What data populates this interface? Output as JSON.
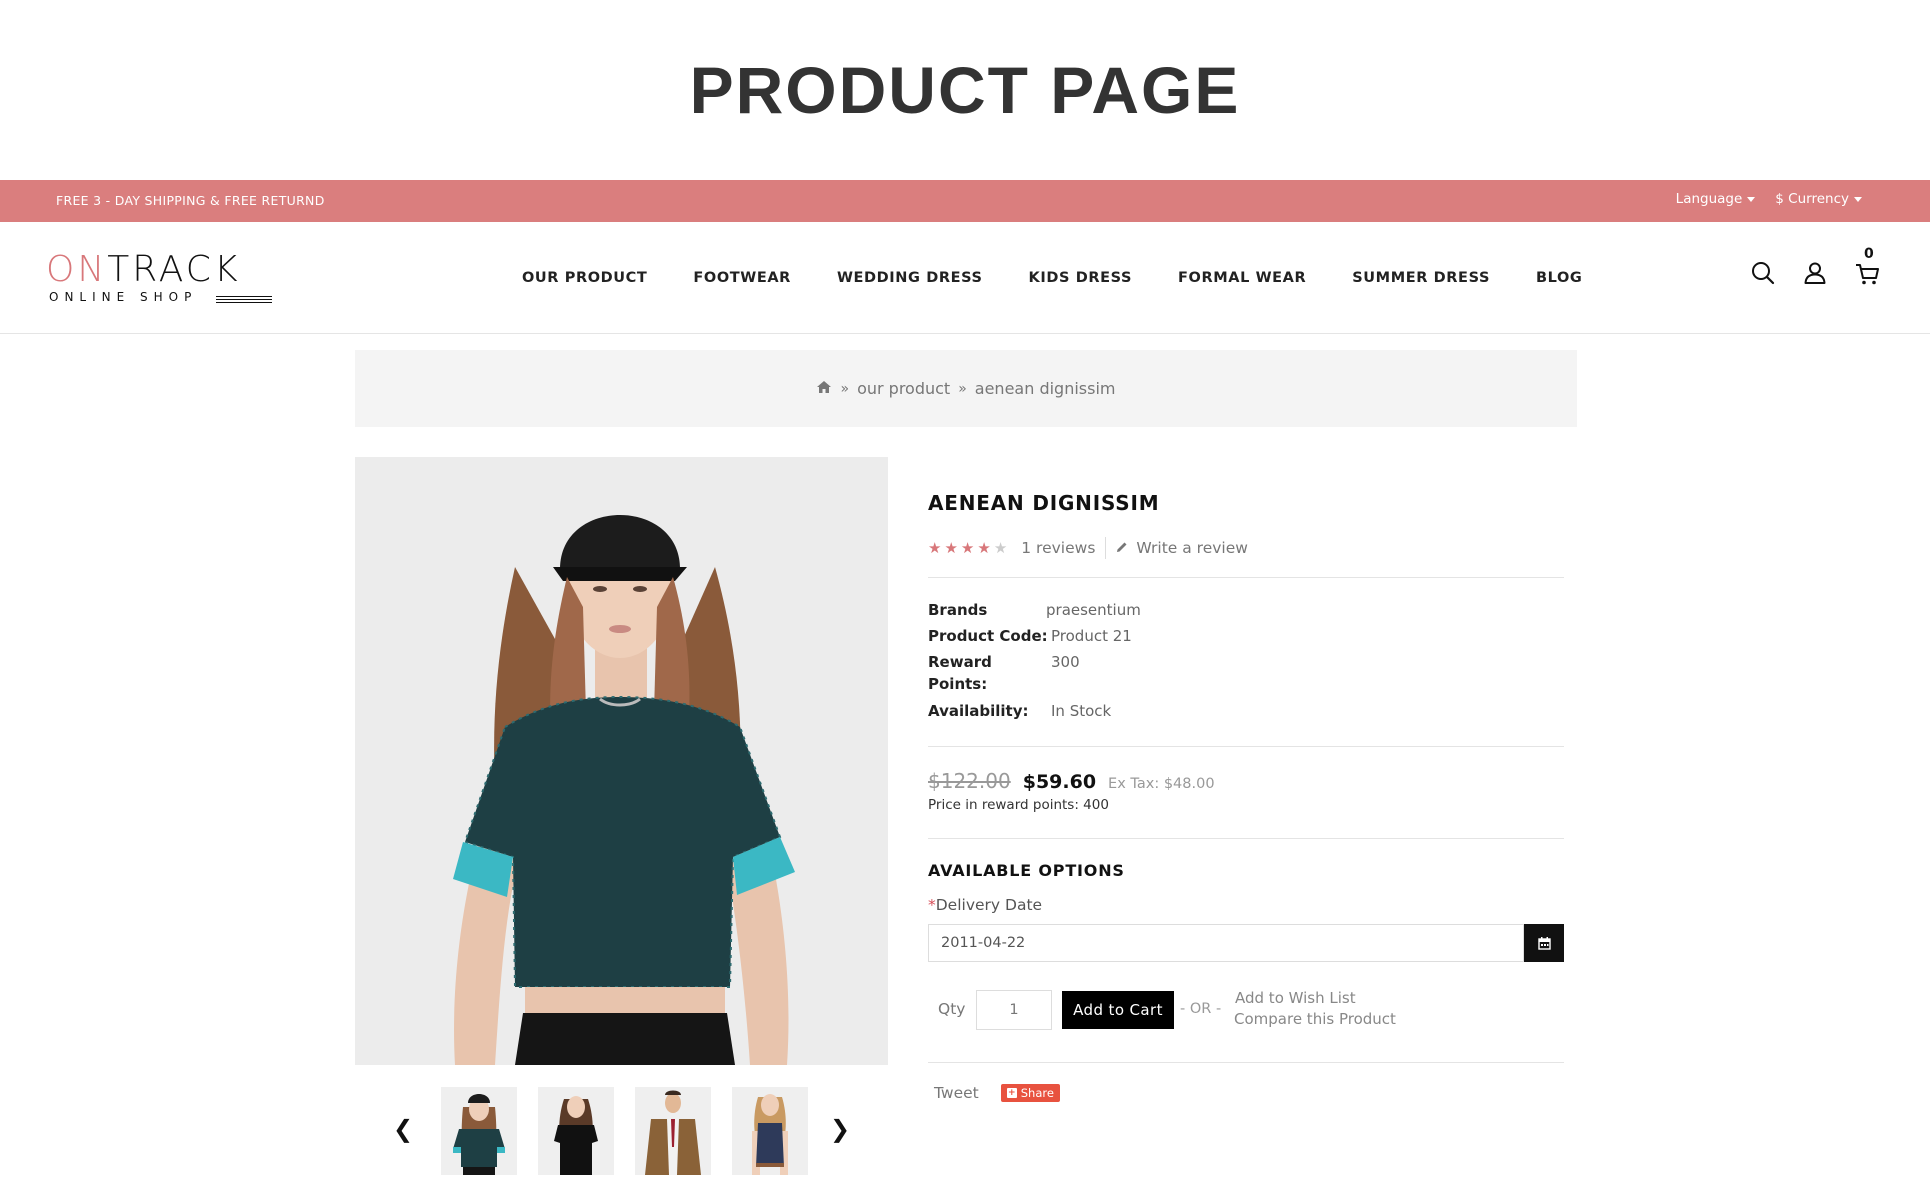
{
  "page": {
    "banner_title": "PRODUCT PAGE"
  },
  "topbar": {
    "promo": "FREE 3 - DAY SHIPPING & FREE RETURND",
    "language": "Language",
    "currency": "$ Currency"
  },
  "logo": {
    "brand_accent": "ON",
    "brand_rest": "TRACK",
    "tagline": "ONLINE SHOP"
  },
  "nav": [
    "OUR PRODUCT",
    "FOOTWEAR",
    "WEDDING DRESS",
    "KIDS DRESS",
    "FORMAL WEAR",
    "SUMMER DRESS",
    "BLOG"
  ],
  "header_icons": {
    "search": "search-icon",
    "account": "user-icon",
    "cart": "cart-icon",
    "cart_count": "0"
  },
  "breadcrumb": {
    "home_icon": "home-icon",
    "items": [
      "our product",
      "aenean dignissim"
    ]
  },
  "product": {
    "title": "AENEAN DIGNISSIM",
    "rating": 4,
    "rating_max": 5,
    "reviews": "1 reviews",
    "write_review": "Write a review",
    "brands_label": "Brands",
    "brands_value": "praesentium",
    "code_label": "Product Code:",
    "code_value": "Product 21",
    "reward_label_1": "Reward",
    "reward_label_2": "Points:",
    "reward_value": "300",
    "availability_label": "Availability:",
    "availability_value": "In Stock",
    "old_price": "$122.00",
    "price": "$59.60",
    "ex_tax": "Ex Tax: $48.00",
    "reward_points_price": "Price in reward points: 400"
  },
  "options": {
    "title": "AVAILABLE OPTIONS",
    "delivery_required": "*",
    "delivery_label": "Delivery Date",
    "delivery_value": "2011-04-22",
    "calendar_icon": "calendar-icon"
  },
  "purchase": {
    "qty_label": "Qty",
    "qty_value": "1",
    "add_to_cart": "Add to Cart",
    "or": "- OR -",
    "wishlist": "Add to Wish List",
    "compare": "Compare this Product"
  },
  "social": {
    "tweet": "Tweet",
    "share": "Share"
  },
  "colors": {
    "accent": "#da7e7e",
    "star_on": "#d8777a",
    "star_off": "#cccccc",
    "share": "#e8523f"
  }
}
